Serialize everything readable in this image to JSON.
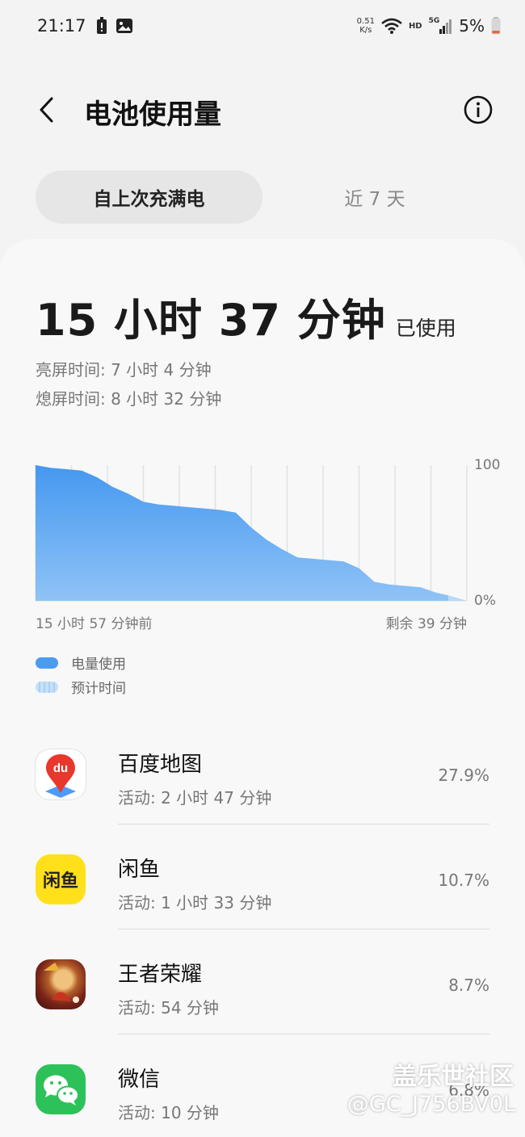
{
  "status_bar": {
    "time": "21:17",
    "net_speed_value": "0.51",
    "net_speed_unit": "K/s",
    "hd": "HD",
    "network": "5G",
    "battery": "5%"
  },
  "header": {
    "title": "电池使用量"
  },
  "tabs": {
    "active": "自上次充满电",
    "inactive": "近 7 天"
  },
  "summary": {
    "total": "15 小时 37 分钟",
    "total_suffix": "已使用",
    "screen_on": "亮屏时间:  7 小时 4 分钟",
    "screen_off": "熄屏时间:   8 小时 32 分钟"
  },
  "chart_data": {
    "type": "area",
    "x_start_label": "15 小时 57 分钟前",
    "x_end_label": "剩余 39 分钟",
    "y_tick_labels": [
      "100",
      "0%"
    ],
    "ylim": [
      0,
      100
    ],
    "grid": true,
    "series": [
      {
        "name": "电量使用",
        "color": "#4a9cf0",
        "points": [
          [
            0,
            100
          ],
          [
            0.5,
            98
          ],
          [
            1.0,
            97
          ],
          [
            1.5,
            96
          ],
          [
            2.0,
            91
          ],
          [
            2.5,
            84
          ],
          [
            3.0,
            79
          ],
          [
            3.5,
            73
          ],
          [
            4.0,
            71
          ],
          [
            4.5,
            70
          ],
          [
            5.0,
            69
          ],
          [
            5.5,
            68
          ],
          [
            6.0,
            67
          ],
          [
            6.5,
            65
          ],
          [
            7.0,
            54
          ],
          [
            7.5,
            45
          ],
          [
            8.0,
            38
          ],
          [
            8.5,
            32
          ],
          [
            9.0,
            31
          ],
          [
            9.5,
            30
          ],
          [
            10.0,
            29
          ],
          [
            10.5,
            24
          ],
          [
            11.0,
            14
          ],
          [
            11.5,
            12
          ],
          [
            12.0,
            11
          ],
          [
            12.5,
            10
          ],
          [
            13.0,
            6
          ],
          [
            13.4,
            4
          ]
        ]
      },
      {
        "name": "预计时间",
        "color": "#b9d9f7",
        "points": [
          [
            13.4,
            4
          ],
          [
            14.0,
            0
          ]
        ]
      }
    ]
  },
  "legend": [
    {
      "label": "电量使用",
      "color": "#4a9cf0"
    },
    {
      "label": "预计时间",
      "color": "#c5e0f8"
    }
  ],
  "apps": [
    {
      "name": "百度地图",
      "activity": "活动: 2 小时 47 分钟",
      "percent": "27.9%",
      "icon": "baidu-maps-icon",
      "icon_text": "du"
    },
    {
      "name": "闲鱼",
      "activity": "活动: 1 小时 33 分钟",
      "percent": "10.7%",
      "icon": "xianyu-icon",
      "icon_text": "闲鱼"
    },
    {
      "name": "王者荣耀",
      "activity": "活动: 54 分钟",
      "percent": "8.7%",
      "icon": "honor-of-kings-icon"
    },
    {
      "name": "微信",
      "activity": "活动: 10 分钟",
      "percent": "6.8%",
      "icon": "wechat-icon"
    }
  ],
  "watermark": {
    "line1": "盖乐世社区",
    "line2": "@GC_J756BV0L"
  }
}
